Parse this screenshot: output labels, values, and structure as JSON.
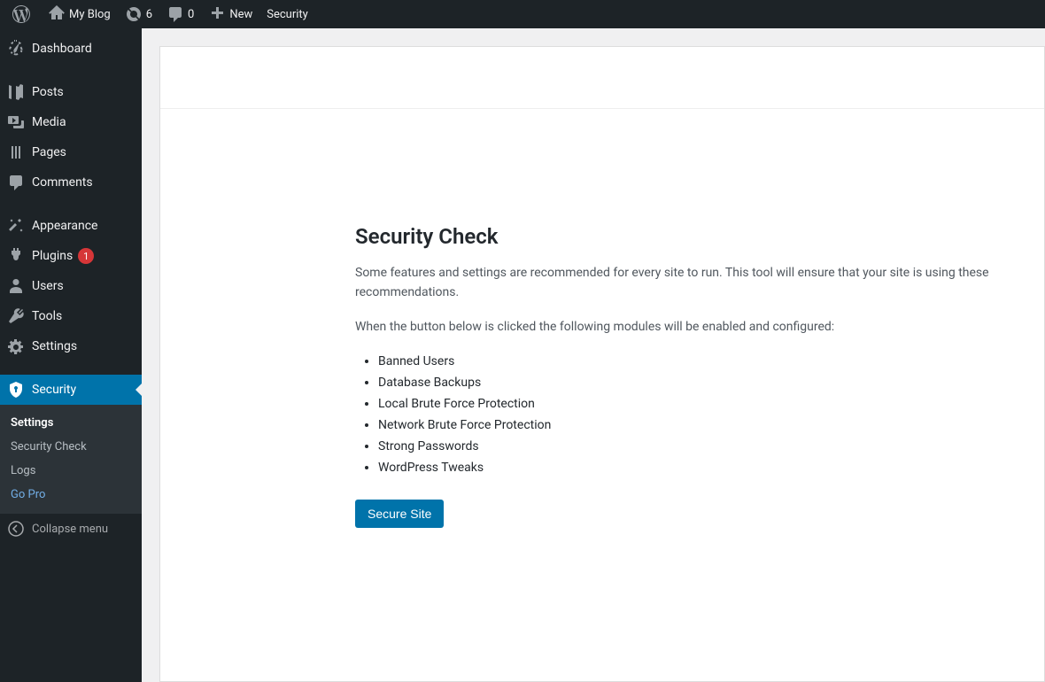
{
  "adminbar": {
    "site_name": "My Blog",
    "updates_count": "6",
    "comments_count": "0",
    "new_label": "New",
    "security_label": "Security"
  },
  "sidebar": {
    "dashboard": "Dashboard",
    "posts": "Posts",
    "media": "Media",
    "pages": "Pages",
    "comments": "Comments",
    "appearance": "Appearance",
    "plugins": "Plugins",
    "plugins_badge": "1",
    "users": "Users",
    "tools": "Tools",
    "settings": "Settings",
    "security": "Security",
    "collapse": "Collapse menu"
  },
  "security_submenu": {
    "settings": "Settings",
    "security_check": "Security Check",
    "logs": "Logs",
    "go_pro": "Go Pro"
  },
  "panel": {
    "title": "Security Check",
    "desc1": "Some features and settings are recommended for every site to run. This tool will ensure that your site is using these recommendations.",
    "desc2": "When the button below is clicked the following modules will be enabled and configured:",
    "modules": {
      "0": "Banned Users",
      "1": "Database Backups",
      "2": "Local Brute Force Protection",
      "3": "Network Brute Force Protection",
      "4": "Strong Passwords",
      "5": "WordPress Tweaks"
    },
    "button": "Secure Site"
  }
}
